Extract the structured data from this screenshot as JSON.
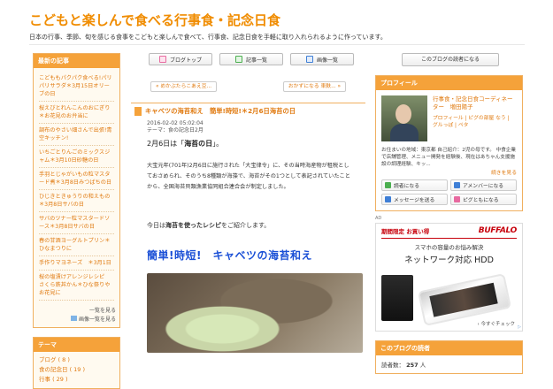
{
  "site": {
    "title": "こどもと楽しんで食べる行事食・記念日食",
    "description": "日本の行事、季節、旬を感じる食事をこどもと楽しんで食べて、行事食、記念日食を手軽に取り入れられるように作っています。"
  },
  "tabs": [
    {
      "label": "ブログトップ",
      "icon": "calendar-icon",
      "color": "#e86aa0"
    },
    {
      "label": "記事一覧",
      "icon": "list-icon",
      "color": "#4caf50"
    },
    {
      "label": "画像一覧",
      "icon": "image-icon",
      "color": "#3f7fd6"
    }
  ],
  "nav": {
    "prev": "« めかぶたらこあえ豆...",
    "next": "おかずになる 車麩... »"
  },
  "article": {
    "title": "キャベツの海苔和え　簡単!時短!＊2月6日海苔の日",
    "date": "2016-02-02 05:02:04",
    "theme": "テーマ：食の記念日2月",
    "lead_prefix": "2月6日は「",
    "lead_bold": "海苔の日",
    "lead_suffix": "」。",
    "paragraph": "大宝元年(701年)2月6日に施行された「大宝律令」に、その当時海産物が租税としておさめられ、そのうち8種類が海藻で、海苔がその1つとして表記されていたことから、全国海苔貝類漁業協同組合連合会が制定しました。",
    "intro_prefix": "今日は",
    "intro_bold": "海苔を使ったレシピ",
    "intro_suffix": "をご紹介します。",
    "recipe_title": "簡単!時短!　キャベツの海苔和え"
  },
  "left": {
    "recent_header": "最新の記事",
    "recent_items": [
      "こどももパクパク食べる!パリパリサラダ＊3月15日オリーブの日",
      "桜えびとれんこんのおにぎり＊お花見のお弁当に",
      "調布のやさい畑さんで出張!青空キッチン!",
      "いちごとりんごのミックスジャム＊3月10日砂糖の日",
      "手羽とじゃがいもの粒マスタード煮＊3月8日みつばちの日",
      "ひじきときゅうりの和えもの＊3月8日サバの日",
      "サバのツナー粒マスタードソース＊3月8日サバの日",
      "春の甘酒ヨーグルトプリン＊ひなまつりに",
      "手作りマヨネーズ　＊3月1日",
      "桜の塩漬けアレンジレシピ　さくら鉄丼かん＊ひな祭りやお花見に"
    ],
    "more_list": "一覧を見る",
    "more_images": "画像一覧を見る",
    "theme_header": "テーマ",
    "themes": [
      "ブログ ( 8 )",
      "食の記念日 ( 19 )",
      "行事 ( 29 )"
    ]
  },
  "right": {
    "reader_button": "このブログの読者になる",
    "profile_header": "プロフィール",
    "profile_name": "行事食・記念日食コーディネーター　増田陽子",
    "profile_links": "プロフィール | ピグの部屋 なう | グルっぽ | ペタ",
    "profile_desc": "お住まいの地域：東京都 自己紹介：2児の母です。 中食企業で店舗管理、メニュー開発を経験後、現在はあちゃん支援施設の調理経験、キッ...",
    "profile_more": "続きを見る",
    "buttons": [
      {
        "label": "読者になる",
        "icon": "reader-icon",
        "color": "#4caf50"
      },
      {
        "label": "アメンバーになる",
        "icon": "amember-icon",
        "color": "#3f7fd6"
      },
      {
        "label": "メッセージを送る",
        "icon": "message-icon",
        "color": "#3f7fd6"
      },
      {
        "label": "ピグともになる",
        "icon": "pigg-icon",
        "color": "#e86aa0"
      }
    ],
    "ad_label": "AD",
    "ad": {
      "limited": "期間限定 お買い得",
      "brand": "BUFFALO",
      "copy1": "スマホの容量のお悩み解決",
      "copy2": "ネットワーク対応 HDD",
      "cta": "今すぐチェック",
      "corner": "▷"
    },
    "readers_header": "このブログの読者",
    "readers_label": "読者数：",
    "readers_count": "257",
    "readers_unit": "人"
  }
}
